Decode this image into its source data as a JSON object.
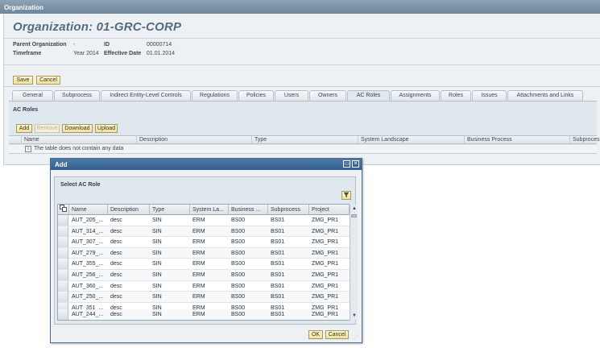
{
  "window": {
    "title": "Organization"
  },
  "header": {
    "title": "Organization: 01-GRC-CORP",
    "fields": {
      "parent_label": "Parent Organization",
      "parent_value": "-",
      "id_label": "ID",
      "id_value": "00000714",
      "timeframe_label": "Timeframe",
      "timeframe_value": "Year 2014",
      "effective_label": "Effective Date",
      "effective_value": "01.01.2014"
    }
  },
  "toolbar": {
    "save": "Save",
    "cancel": "Cancel"
  },
  "tabs": [
    "General",
    "Subprocess",
    "Indirect Entity-Level Controls",
    "Regulations",
    "Policies",
    "Users",
    "Owners",
    "AC Roles",
    "Assignments",
    "Roles",
    "Issues",
    "Attachments and Links"
  ],
  "active_tab": "AC Roles",
  "ac_roles": {
    "title": "AC Roles",
    "buttons": {
      "add": "Add",
      "remove": "Remove",
      "download": "Download",
      "upload": "Upload"
    },
    "columns": [
      "Name",
      "Description",
      "Type",
      "System Landscape",
      "Business Process",
      "Subprocess"
    ],
    "empty_text": "The table does not contain any data",
    "empty_icon": "i"
  },
  "dialog": {
    "title": "Add",
    "section_title": "Select AC Role",
    "controls": {
      "maximize": "▭",
      "close": "✕"
    },
    "filter_icon": "funnel-icon",
    "columns": [
      "Name",
      "Description",
      "Type",
      "System La...",
      "Business ...",
      "Subprocess",
      "Project"
    ],
    "rows": [
      [
        "AUT_205_...",
        "desc",
        "SIN",
        "ERM",
        "BS00",
        "BS01",
        "ZMG_PR1"
      ],
      [
        "AUT_314_...",
        "desc",
        "SIN",
        "ERM",
        "BS00",
        "BS01",
        "ZMG_PR1"
      ],
      [
        "AUT_307_...",
        "desc",
        "SIN",
        "ERM",
        "BS00",
        "BS01",
        "ZMG_PR1"
      ],
      [
        "AUT_279_...",
        "desc",
        "SIN",
        "ERM",
        "BS00",
        "BS01",
        "ZMG_PR1"
      ],
      [
        "AUT_355_...",
        "desc",
        "SIN",
        "ERM",
        "BS00",
        "BS01",
        "ZMG_PR1"
      ],
      [
        "AUT_256_...",
        "desc",
        "SIN",
        "ERM",
        "BS00",
        "BS01",
        "ZMG_PR1"
      ],
      [
        "AUT_360_...",
        "desc",
        "SIN",
        "ERM",
        "BS00",
        "BS01",
        "ZMG_PR1"
      ],
      [
        "AUT_250_...",
        "desc",
        "SIN",
        "ERM",
        "BS00",
        "BS01",
        "ZMG_PR1"
      ],
      [
        "AUT_351_...",
        "desc",
        "SIN",
        "ERM",
        "BS00",
        "BS01",
        "ZMG_PR1"
      ],
      [
        "AUT_244_...",
        "desc",
        "SIN",
        "ERM",
        "BS00",
        "BS01",
        "ZMG_PR1"
      ]
    ],
    "ok": "OK",
    "cancel": "Cancel"
  }
}
